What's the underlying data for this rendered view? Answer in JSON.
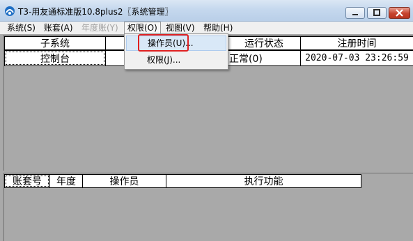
{
  "window": {
    "title": "T3-用友通标准版10.8plus2〖系统管理〗",
    "minimize_icon": "minimize-icon",
    "maximize_icon": "maximize-icon",
    "close_icon": "close-icon"
  },
  "menubar": {
    "items": [
      {
        "label": "系统(S)",
        "enabled": true
      },
      {
        "label": "账套(A)",
        "enabled": true
      },
      {
        "label": "年度账(Y)",
        "enabled": false
      },
      {
        "label": "权限(O)",
        "enabled": true,
        "active": true
      },
      {
        "label": "视图(V)",
        "enabled": true
      },
      {
        "label": "帮助(H)",
        "enabled": true
      }
    ]
  },
  "permissions_menu": {
    "items": [
      {
        "label": "操作员(U)...",
        "highlighted": true
      },
      {
        "label": "权限(J)..."
      }
    ]
  },
  "subsystem_table": {
    "headers": [
      "子系统",
      "",
      "运行状态",
      "注册时间"
    ],
    "rows": [
      [
        "控制台",
        "",
        "正常(0)",
        "2020-07-03 23:26:59"
      ]
    ]
  },
  "task_table": {
    "headers": [
      "账套号",
      "年度",
      "操作员",
      "执行功能"
    ]
  },
  "colors": {
    "background": "#a9a9a9",
    "highlight_box": "#e02020",
    "menu_hover": "#d9e8f7"
  }
}
